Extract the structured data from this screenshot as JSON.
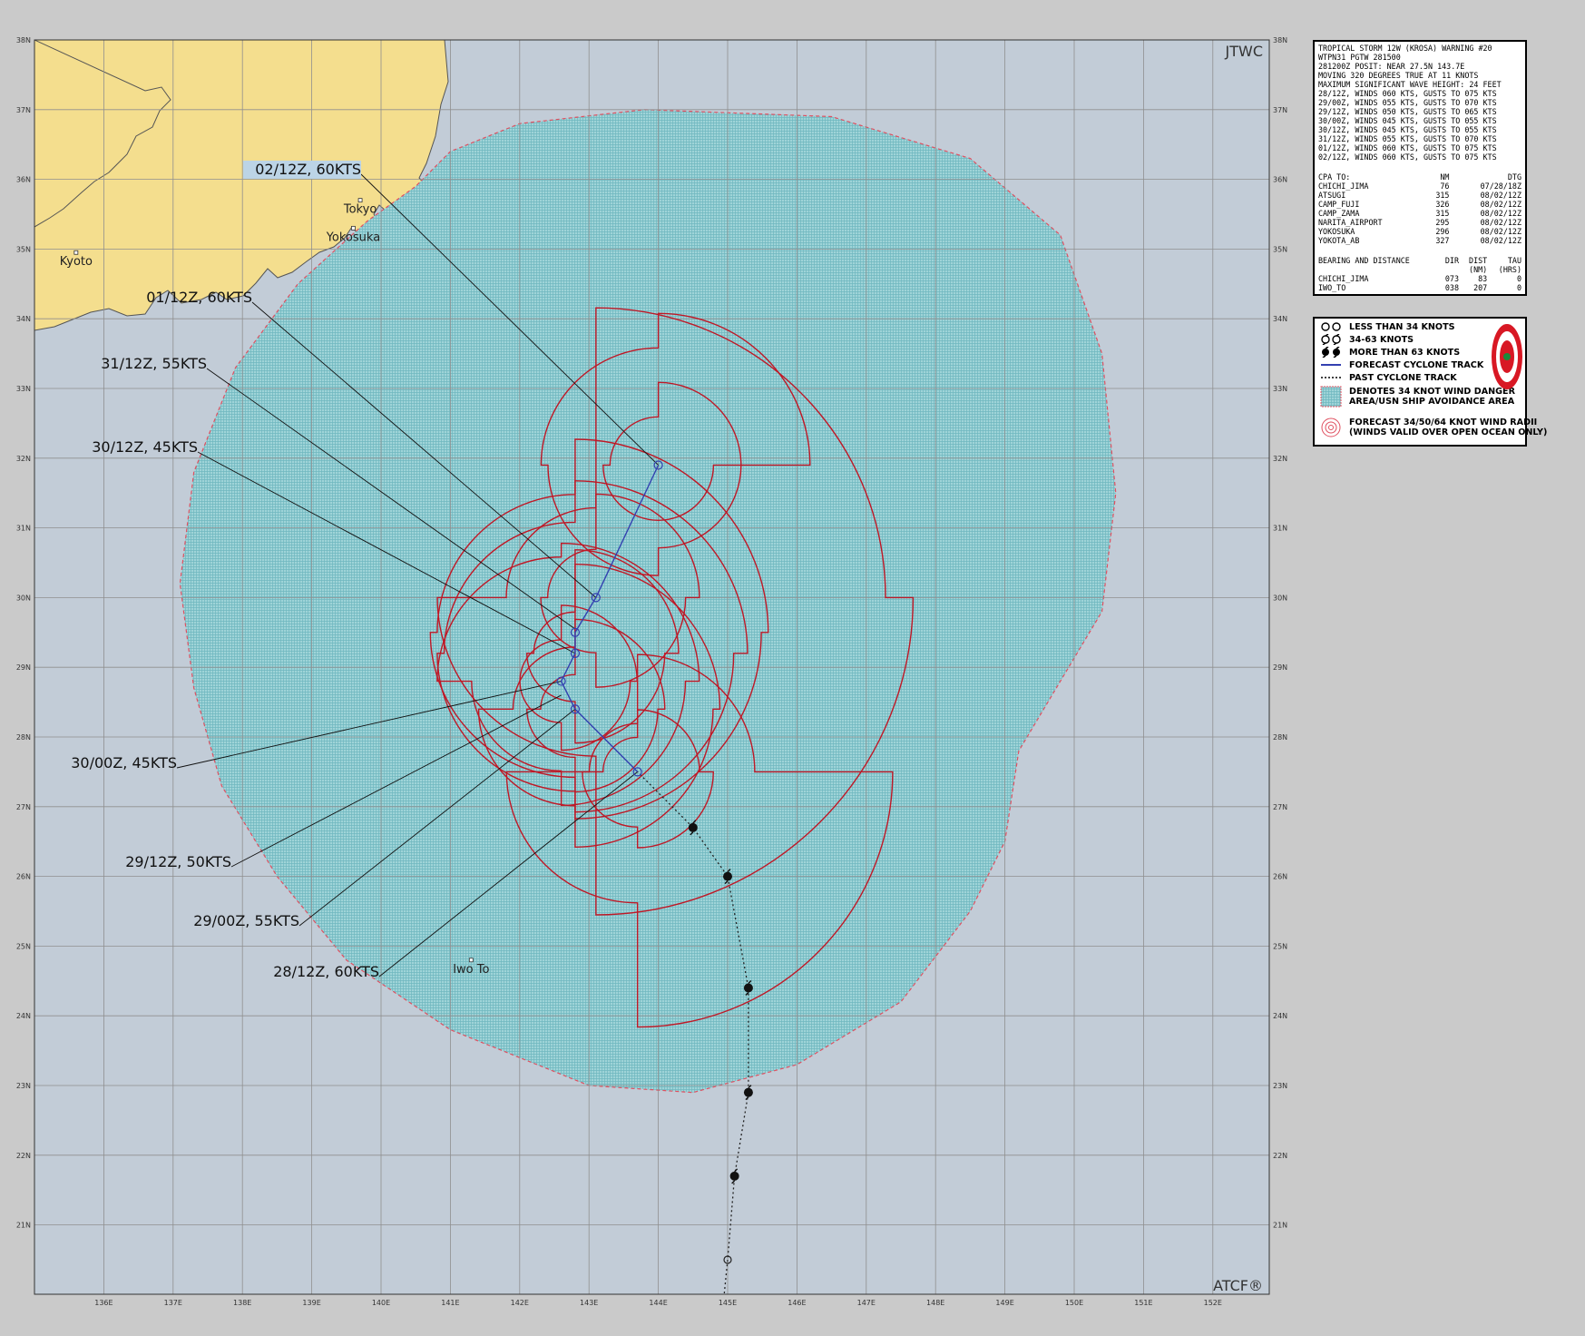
{
  "colors": {
    "ocean": "#c2ccd7",
    "land": "#f4de8e",
    "grid": "#8f8f8f",
    "danger": "#7fc2c8",
    "radii": "#bf1826",
    "track": "#3340b0",
    "past": "#222222",
    "label_bg": "#bcd4e6"
  },
  "map": {
    "corner_top": "JTWC",
    "corner_bottom": "ATCF®",
    "lat_labels": [
      "38N",
      "37N",
      "36N",
      "35N",
      "34N",
      "33N",
      "32N",
      "31N",
      "30N",
      "29N",
      "28N",
      "27N",
      "26N",
      "25N",
      "24N",
      "23N",
      "22N",
      "21N"
    ],
    "lon_labels": [
      "136E",
      "137E",
      "138E",
      "139E",
      "140E",
      "141E",
      "142E",
      "143E",
      "144E",
      "145E",
      "146E",
      "147E",
      "148E",
      "149E",
      "150E",
      "151E",
      "152E"
    ],
    "places": [
      {
        "name": "Kyoto",
        "lon": 135.6,
        "lat": 34.95
      },
      {
        "name": "Tokyo",
        "lon": 139.7,
        "lat": 35.7
      },
      {
        "name": "Yokosuka",
        "lon": 139.6,
        "lat": 35.3
      },
      {
        "name": "Iwo To",
        "lon": 141.3,
        "lat": 24.8
      }
    ],
    "forecast_labels": [
      {
        "text": "02/12Z,  60KTS",
        "lon": 144.0,
        "lat": 31.9,
        "highlight": true
      },
      {
        "text": "01/12Z,  60KTS",
        "lon": 143.1,
        "lat": 30.0,
        "highlight": false
      },
      {
        "text": "31/12Z,  55KTS",
        "lon": 142.8,
        "lat": 29.55,
        "highlight": false
      },
      {
        "text": "30/12Z,  45KTS",
        "lon": 142.8,
        "lat": 29.2,
        "highlight": false
      },
      {
        "text": "30/00Z,  45KTS",
        "lon": 142.6,
        "lat": 28.8,
        "highlight": false
      },
      {
        "text": "29/12Z,  50KTS",
        "lon": 142.6,
        "lat": 28.6,
        "highlight": false
      },
      {
        "text": "29/00Z,  55KTS",
        "lon": 142.8,
        "lat": 28.4,
        "highlight": false
      },
      {
        "text": "28/12Z,  60KTS",
        "lon": 143.7,
        "lat": 27.5,
        "highlight": false
      }
    ],
    "forecast_track": [
      [
        143.7,
        27.5
      ],
      [
        142.8,
        28.4
      ],
      [
        142.6,
        28.8
      ],
      [
        142.8,
        29.2
      ],
      [
        142.8,
        29.5
      ],
      [
        143.1,
        30.0
      ],
      [
        144.0,
        31.9
      ]
    ],
    "past_track": [
      [
        144.9,
        19.5
      ],
      [
        145.0,
        20.5
      ],
      [
        145.1,
        21.7
      ],
      [
        145.3,
        22.9
      ],
      [
        145.3,
        24.4
      ],
      [
        145.0,
        26.0
      ],
      [
        144.5,
        26.7
      ],
      [
        143.7,
        27.5
      ]
    ],
    "past_fixes": [
      {
        "lon": 145.0,
        "lat": 20.5,
        "intensity": "less than 34"
      },
      {
        "lon": 145.1,
        "lat": 21.7,
        "intensity": "34-63"
      },
      {
        "lon": 145.3,
        "lat": 22.9,
        "intensity": "34-63"
      },
      {
        "lon": 145.3,
        "lat": 24.4,
        "intensity": "34-63"
      },
      {
        "lon": 145.0,
        "lat": 26.0,
        "intensity": "34-63"
      },
      {
        "lon": 144.5,
        "lat": 26.7,
        "intensity": "34-63"
      }
    ]
  },
  "warning": {
    "header": [
      "TROPICAL STORM 12W (KROSA) WARNING #20",
      "WTPN31 PGTW 281500",
      "281200Z POSIT: NEAR 27.5N 143.7E",
      "MOVING 320 DEGREES TRUE AT 11 KNOTS",
      "MAXIMUM SIGNIFICANT WAVE HEIGHT: 24 FEET",
      "28/12Z, WINDS 060 KTS, GUSTS TO 075 KTS",
      "29/00Z, WINDS 055 KTS, GUSTS TO 070 KTS",
      "29/12Z, WINDS 050 KTS, GUSTS TO 065 KTS",
      "30/00Z, WINDS 045 KTS, GUSTS TO 055 KTS",
      "30/12Z, WINDS 045 KTS, GUSTS TO 055 KTS",
      "31/12Z, WINDS 055 KTS, GUSTS TO 070 KTS",
      "01/12Z, WINDS 060 KTS, GUSTS TO 075 KTS",
      "02/12Z, WINDS 060 KTS, GUSTS TO 075 KTS"
    ],
    "cpa_headers": [
      "CPA TO:",
      "NM",
      "DTG"
    ],
    "cpa_rows": [
      [
        "CHICHI_JIMA",
        "76",
        "07/28/18Z"
      ],
      [
        "ATSUGI",
        "315",
        "08/02/12Z"
      ],
      [
        "CAMP_FUJI",
        "326",
        "08/02/12Z"
      ],
      [
        "CAMP_ZAMA",
        "315",
        "08/02/12Z"
      ],
      [
        "NARITA_AIRPORT",
        "295",
        "08/02/12Z"
      ],
      [
        "YOKOSUKA",
        "296",
        "08/02/12Z"
      ],
      [
        "YOKOTA_AB",
        "327",
        "08/02/12Z"
      ]
    ],
    "bearing_headers": [
      "BEARING AND DISTANCE",
      "DIR",
      "DIST",
      "TAU"
    ],
    "bearing_subheaders": [
      "",
      "",
      "(NM)",
      "(HRS)"
    ],
    "bearing_rows": [
      [
        "CHICHI_JIMA",
        "073",
        "83",
        "0"
      ],
      [
        "IWO_TO",
        "038",
        "207",
        "0"
      ]
    ]
  },
  "legend": {
    "less34": "LESS THAN 34 KNOTS",
    "k34_63": "34-63 KNOTS",
    "more63": "MORE THAN 63 KNOTS",
    "forecast_track": "FORECAST CYCLONE TRACK",
    "past_track": "PAST CYCLONE TRACK",
    "danger1": "DENOTES 34 KNOT WIND DANGER",
    "danger2": "AREA/USN SHIP AVOIDANCE AREA",
    "radii1": "FORECAST 34/50/64 KNOT WIND RADII",
    "radii2": "(WINDS VALID OVER OPEN OCEAN ONLY)"
  }
}
